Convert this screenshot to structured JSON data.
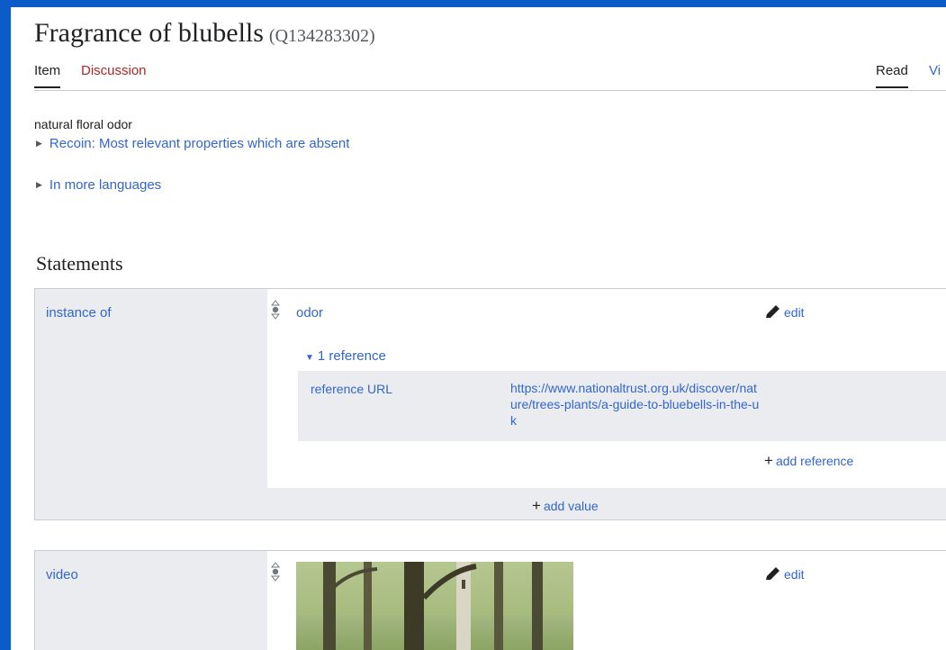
{
  "page": {
    "title": "Fragrance of blubells",
    "qid": "(Q134283302)"
  },
  "tabs": {
    "item": "Item",
    "discussion": "Discussion",
    "read": "Read",
    "view": "Vi"
  },
  "description": "natural floral odor",
  "toggles": {
    "recoin": "Recoin: Most relevant properties which are absent",
    "languages": "In more languages"
  },
  "statements": {
    "heading": "Statements",
    "groups": [
      {
        "property": "instance of",
        "value": "odor",
        "edit_label": "edit",
        "references_toggle": "1 reference",
        "reference": {
          "property": "reference URL",
          "value": "https://www.nationaltrust.org.uk/discover/nature/trees-plants/a-guide-to-bluebells-in-the-uk"
        },
        "add_reference": "add reference",
        "add_value": "add value"
      },
      {
        "property": "video",
        "edit_label": "edit"
      }
    ]
  },
  "icons": {
    "rank": "rank-normal-icon",
    "edit": "pencil-icon",
    "expand": "triangle-right-icon",
    "collapse": "triangle-down-icon",
    "add": "plus-icon"
  },
  "colors": {
    "link": "#3366cc",
    "discussion_link": "#b32424",
    "statement_bg": "#eaecf0",
    "frame": "#0b5cc9"
  }
}
